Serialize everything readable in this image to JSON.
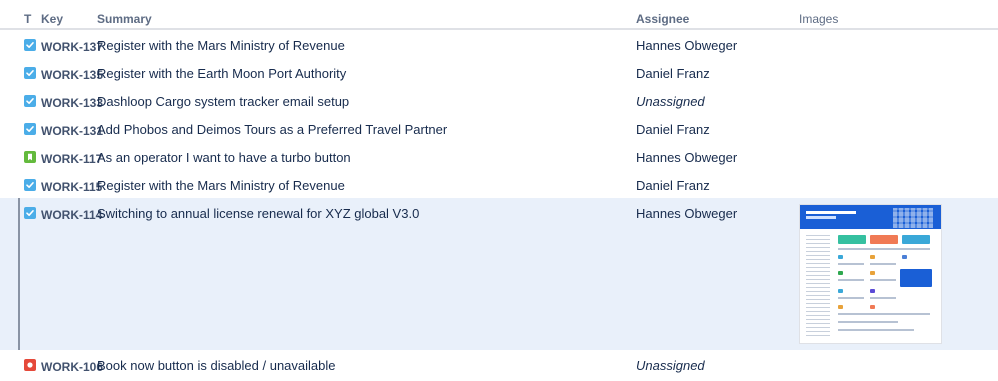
{
  "columns": {
    "type": "T",
    "key": "Key",
    "summary": "Summary",
    "assignee": "Assignee",
    "images": "Images"
  },
  "rows": [
    {
      "type": "task",
      "key": "WORK-137",
      "summary": "Register with the Mars Ministry of Revenue",
      "assignee": "Hannes Obweger"
    },
    {
      "type": "task",
      "key": "WORK-135",
      "summary": "Register with the Earth Moon Port Authority",
      "assignee": "Daniel Franz"
    },
    {
      "type": "task",
      "key": "WORK-133",
      "summary": "Dashloop Cargo system tracker email setup",
      "assignee": "Unassigned"
    },
    {
      "type": "task",
      "key": "WORK-131",
      "summary": "Add Phobos and Deimos Tours as a Preferred Travel Partner",
      "assignee": "Daniel Franz"
    },
    {
      "type": "story",
      "key": "WORK-117",
      "summary": "As an operator I want to have a turbo button",
      "assignee": "Hannes Obweger"
    },
    {
      "type": "task",
      "key": "WORK-115",
      "summary": "Register with the Mars Ministry of Revenue",
      "assignee": "Daniel Franz"
    },
    {
      "type": "task",
      "key": "WORK-114",
      "summary": "Switching to annual license renewal for XYZ global V3.0",
      "assignee": "Hannes Obweger",
      "has_image": true
    },
    {
      "type": "bug",
      "key": "WORK-106",
      "summary": "Book now button is disabled / unavailable",
      "assignee": "Unassigned"
    }
  ],
  "icons": {
    "task": "task-checkbox-icon",
    "story": "story-bookmark-icon",
    "bug": "bug-icon"
  },
  "colors": {
    "task": "#4bade8",
    "story": "#63ba3c",
    "bug": "#e5493a",
    "selected_row": "#e9f0fa"
  }
}
